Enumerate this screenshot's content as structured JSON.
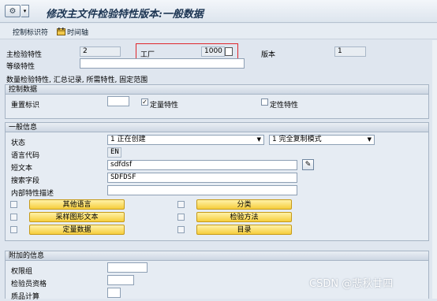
{
  "title_bar": {
    "title": "修改主文件检验特性版本:一般数据",
    "menu_glyph": "▾"
  },
  "toolbar": {
    "control_ids_label": "控制标识符",
    "timeline_label": "时间轴"
  },
  "header": {
    "master_char_label": "主检验特性",
    "master_char_value": "2",
    "plant_label": "工厂",
    "plant_value": "1000",
    "version_label": "版本",
    "version_value": "1",
    "class_char_label": "等级特性",
    "class_char_value": "",
    "data_note": "数量检验特性, 汇总记录, 所需特性, 固定范围"
  },
  "control_data": {
    "heading": "控制数据",
    "reference_id_label": "重置标识",
    "reference_id_value": "",
    "quantitative_label": "定量特性",
    "quantitative_checked": "✓",
    "qualitative_label": "定性特性"
  },
  "general_info": {
    "heading": "一般信息",
    "status_label": "状态",
    "status_value": "1 正在创建",
    "copy_mode_value": "1 完全复制模式",
    "language_label": "语言代码",
    "language_value": "EN",
    "short_text_label": "短文本",
    "short_text_value": "sdfdsf",
    "search_field_label": "搜索字段",
    "search_field_value": "SDFDSF",
    "internal_desc_label": "内部特性描述",
    "internal_desc_value": "",
    "buttons": {
      "other_languages": "其他语言",
      "sample_text": "采样图形文本",
      "quantitative_data": "定量数据",
      "classification": "分类",
      "inspection_method": "检验方法",
      "catalog": "目录"
    }
  },
  "additional_info": {
    "heading": "附加的信息",
    "authorization_label": "权限组",
    "inspector_label": "检验员资格",
    "qscore_label": "质品计算"
  },
  "watermark": "CSDN @悲秋廿四"
}
